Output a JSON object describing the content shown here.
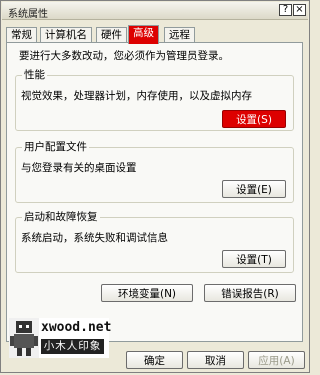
{
  "window": {
    "title": "系统属性",
    "help_label": "?",
    "close_label": "×"
  },
  "tabs": [
    {
      "label": "常规",
      "active": false
    },
    {
      "label": "计算机名",
      "active": false
    },
    {
      "label": "硬件",
      "active": false
    },
    {
      "label": "高级",
      "active": true
    },
    {
      "label": "远程",
      "active": false
    }
  ],
  "notice": "要进行大多数改动，您必须作为管理员登录。",
  "groups": {
    "performance": {
      "title": "性能",
      "description": "视觉效果，处理器计划，内存使用，以及虚拟内存",
      "button": "设置(S)"
    },
    "profiles": {
      "title": "用户配置文件",
      "description": "与您登录有关的桌面设置",
      "button": "设置(E)"
    },
    "startup": {
      "title": "启动和故障恢复",
      "description": "系统启动，系统失败和调试信息",
      "button": "设置(T)"
    }
  },
  "buttons": {
    "env_vars": "环境变量(N)",
    "error_report": "错误报告(R)",
    "ok": "确定",
    "cancel": "取消",
    "apply": "应用(A)"
  },
  "watermark": {
    "site": "xwood.net",
    "name": "小木人印象"
  },
  "colors": {
    "highlight": "#dd0000",
    "dialog_bg": "#ece9d8"
  }
}
